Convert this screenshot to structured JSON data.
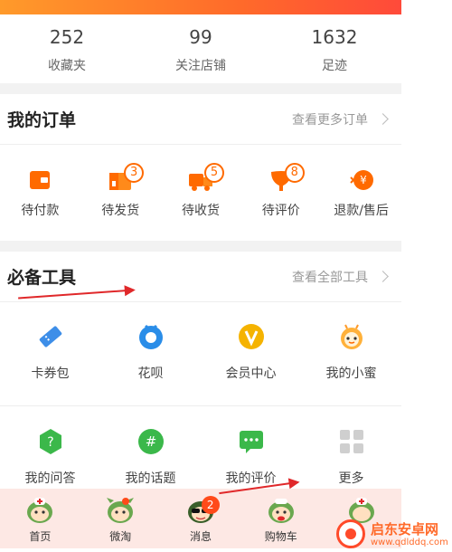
{
  "stats": [
    {
      "value": "252",
      "label": "收藏夹"
    },
    {
      "value": "99",
      "label": "关注店铺"
    },
    {
      "value": "1632",
      "label": "足迹"
    }
  ],
  "orders": {
    "title": "我的订单",
    "more": "查看更多订单",
    "items": [
      {
        "label": "待付款",
        "icon": "wallet-icon",
        "badge": ""
      },
      {
        "label": "待发货",
        "icon": "package-icon",
        "badge": "3"
      },
      {
        "label": "待收货",
        "icon": "truck-icon",
        "badge": "5"
      },
      {
        "label": "待评价",
        "icon": "review-icon",
        "badge": "8"
      },
      {
        "label": "退款/售后",
        "icon": "refund-icon",
        "badge": ""
      }
    ]
  },
  "tools": {
    "title": "必备工具",
    "more": "查看全部工具",
    "row1": [
      {
        "label": "卡券包",
        "icon": "coupon-icon",
        "color": "#3d8ee8"
      },
      {
        "label": "花呗",
        "icon": "huabei-icon",
        "color": "#2a8de8"
      },
      {
        "label": "会员中心",
        "icon": "vip-icon",
        "color": "#f5b300"
      },
      {
        "label": "我的小蜜",
        "icon": "assistant-icon",
        "color": "#ff9a2a"
      }
    ],
    "row2": [
      {
        "label": "我的问答",
        "icon": "qa-icon",
        "color": "#3bb84a"
      },
      {
        "label": "我的话题",
        "icon": "topic-icon",
        "color": "#3bb84a"
      },
      {
        "label": "我的评价",
        "icon": "comment-icon",
        "color": "#3bb84a"
      },
      {
        "label": "更多",
        "icon": "grid-icon",
        "color": "#cfcfcf"
      }
    ]
  },
  "tabbar": [
    {
      "label": "首页",
      "icon": "home-icon",
      "badge": ""
    },
    {
      "label": "微淘",
      "icon": "weitao-icon",
      "badge": "dot"
    },
    {
      "label": "消息",
      "icon": "message-icon",
      "badge": "2"
    },
    {
      "label": "购物车",
      "icon": "cart-icon",
      "badge": ""
    },
    {
      "label": "",
      "icon": "mine-icon",
      "badge": ""
    }
  ],
  "watermark": {
    "title": "启东安卓网",
    "url": "www.qdlddq.com"
  },
  "colors": {
    "accent": "#ff6a00",
    "annotation": "#e0282a",
    "tabbar_bg": "#fde8e4"
  }
}
